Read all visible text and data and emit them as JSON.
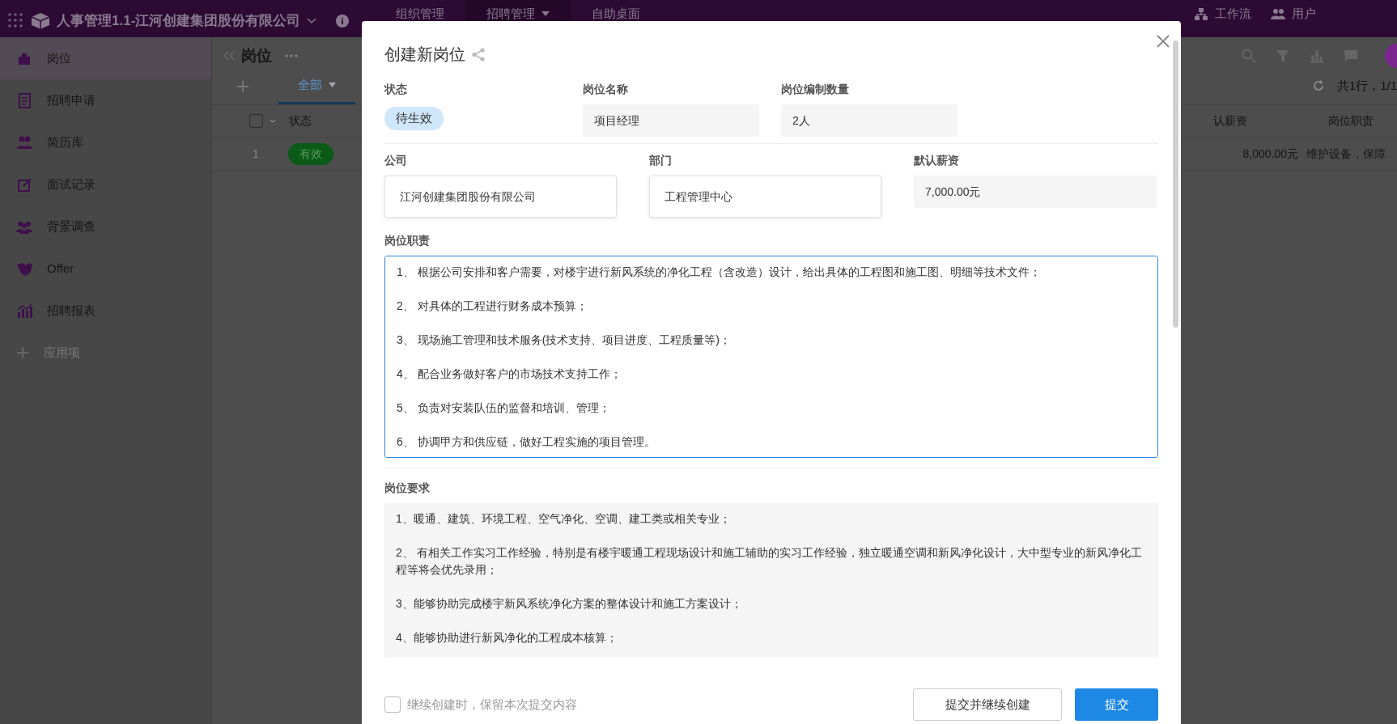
{
  "top_bar": {
    "app_title": "人事管理1.1-江河创建集团股份有限公司",
    "nav": [
      {
        "label": "组织管理",
        "selected": false,
        "dropdown": false
      },
      {
        "label": "招聘管理",
        "selected": true,
        "dropdown": true
      },
      {
        "label": "自助桌面",
        "selected": false,
        "dropdown": false
      }
    ],
    "right_links": [
      {
        "label": "工作流"
      },
      {
        "label": "用户"
      }
    ]
  },
  "sidebar": {
    "items": [
      {
        "label": "岗位",
        "selected": true
      },
      {
        "label": "招聘申请",
        "selected": false
      },
      {
        "label": "简历库",
        "selected": false
      },
      {
        "label": "面试记录",
        "selected": false
      },
      {
        "label": "背景调查",
        "selected": false
      },
      {
        "label": "Offer",
        "selected": false
      },
      {
        "label": "招聘报表",
        "selected": false
      }
    ],
    "add_item": "应用项"
  },
  "page": {
    "title": "岗位",
    "tabs": [
      {
        "label": "全部",
        "selected": true
      }
    ],
    "summary": "共1行，1/1",
    "table": {
      "all_selected": false,
      "columns": [
        "状态",
        "认薪资",
        "岗位职责"
      ],
      "rows": [
        {
          "row_number": "1",
          "status": "有效",
          "salary": "8,000.00元",
          "duties": "维护设备，保障"
        }
      ]
    }
  },
  "dialog": {
    "title": "创建新岗位",
    "fields": [
      {
        "label": "状态",
        "value": "待生效",
        "kind": "tag"
      },
      {
        "label": "岗位名称",
        "value": "项目经理",
        "kind": "readonly"
      },
      {
        "label": "岗位编制数量",
        "value": "2人",
        "kind": "readonly"
      },
      {
        "label": "公司",
        "value": "江河创建集团股份有限公司",
        "kind": "input"
      },
      {
        "label": "部门",
        "value": "工程管理中心",
        "kind": "input"
      },
      {
        "label": "默认薪资",
        "value": "7,000.00元",
        "kind": "readonly"
      }
    ],
    "duties": {
      "label": "岗位职责",
      "focused": true,
      "lines": [
        "1、 根据公司安排和客户需要，对楼宇进行新风系统的净化工程（含改造）设计，给出具体的工程图和施工图、明细等技术文件；",
        "2、 对具体的工程进行财务成本预算；",
        "3、 现场施工管理和技术服务(技术支持、项目进度、工程质量等)；",
        "4、 配合业务做好客户的市场技术支持工作；",
        "5、 负责对安装队伍的监督和培训、管理；",
        "6、 协调甲方和供应链，做好工程实施的项目管理。"
      ]
    },
    "requirements": {
      "label": "岗位要求",
      "lines": [
        "1、暖通、建筑、环境工程、空气净化、空调、建工类或相关专业；",
        "2、 有相关工作实习工作经验，特别是有楼宇暖通工程现场设计和施工辅助的实习工作经验，独立暖通空调和新风净化设计，大中型专业的新风净化工程等将会优先录用；",
        "3、能够协助完成楼宇新风系统净化方案的整体设计和施工方案设计；",
        "4、能够协助进行新风净化的工程成本核算；"
      ]
    },
    "keep_content": {
      "label": "继续创建时，保留本次提交内容",
      "checked": false
    },
    "buttons": [
      {
        "label": "提交并继续创建",
        "kind": "secondary"
      },
      {
        "label": "提交",
        "kind": "primary"
      }
    ]
  }
}
